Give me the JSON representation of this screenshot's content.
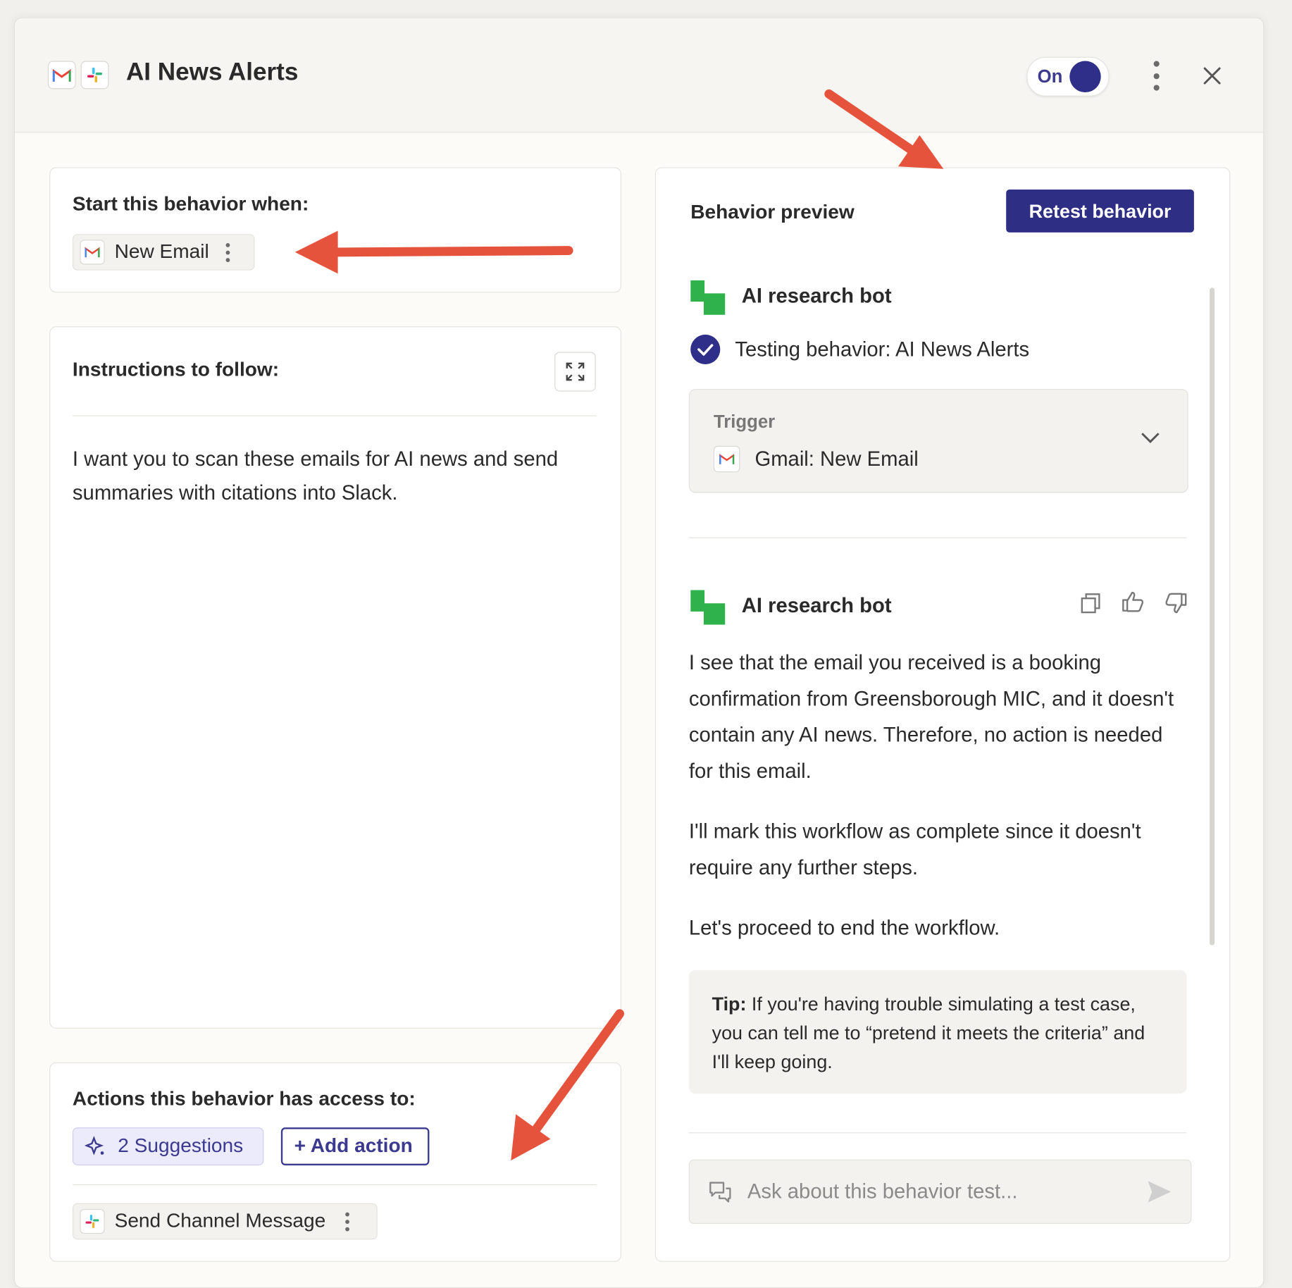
{
  "header": {
    "title": "AI News Alerts",
    "toggle_label": "On",
    "icons": [
      "gmail-icon",
      "slack-icon",
      "kebab-menu-icon",
      "close-icon"
    ]
  },
  "trigger_card": {
    "label": "Start this behavior when:",
    "trigger_chip": "New Email"
  },
  "instructions_card": {
    "label": "Instructions to follow:",
    "text": "I want you to scan these emails for AI news and send summaries with citations into Slack."
  },
  "actions_card": {
    "label": "Actions this behavior has access to:",
    "suggestions_label": "2 Suggestions",
    "add_action_label": "+ Add action",
    "action_chip": "Send Channel Message"
  },
  "preview": {
    "label": "Behavior preview",
    "retest_label": "Retest behavior",
    "bot_name": "AI research bot",
    "status_text": "Testing behavior: AI News Alerts",
    "trigger_box": {
      "label": "Trigger",
      "value": "Gmail: New Email"
    },
    "reply": {
      "bot_name": "AI research bot",
      "paragraphs": [
        "I see that the email you received is a booking confirmation from Greensborough MIC, and it doesn't contain any AI news. Therefore, no action is needed for this email.",
        "I'll mark this workflow as complete since it doesn't require any further steps.",
        "Let's proceed to end the workflow."
      ]
    },
    "tip": {
      "label": "Tip:",
      "text": " If you're having trouble simulating a test case, you can tell me to “pretend it meets the criteria” and I'll keep going."
    },
    "ask_placeholder": "Ask about this behavior test..."
  },
  "colors": {
    "accent": "#2e2e85",
    "bot_green": "#2fb24c",
    "annotation_arrow": "#e5533d"
  }
}
